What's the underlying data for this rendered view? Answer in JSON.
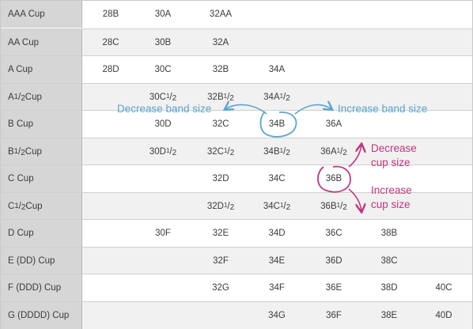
{
  "columns": [
    "col1",
    "col2",
    "col3",
    "col4",
    "col5",
    "col6",
    "col7"
  ],
  "rows": [
    {
      "label": "AAA Cup",
      "cells": [
        "28B",
        "30A",
        "32AA",
        "",
        "",
        "",
        ""
      ]
    },
    {
      "label": "AA Cup",
      "cells": [
        "28C",
        "30B",
        "32A",
        "",
        "",
        "",
        ""
      ]
    },
    {
      "label": "A Cup",
      "cells": [
        "28D",
        "30C",
        "32B",
        "34A",
        "",
        "",
        ""
      ]
    },
    {
      "label": "A 1/2 Cup",
      "cells": [
        "",
        "30C1/2",
        "32B1/2",
        "34A1/2",
        "",
        "",
        ""
      ]
    },
    {
      "label": "B Cup",
      "cells": [
        "",
        "30D",
        "32C",
        "34B",
        "36A",
        "",
        ""
      ]
    },
    {
      "label": "B 1/2 Cup",
      "cells": [
        "",
        "30D1/2",
        "32C1/2",
        "34B1/2",
        "36A1/2",
        "",
        ""
      ]
    },
    {
      "label": "C Cup",
      "cells": [
        "",
        "",
        "32D",
        "34C",
        "36B",
        "",
        ""
      ]
    },
    {
      "label": "C 1/2 Cup",
      "cells": [
        "",
        "",
        "32D1/2",
        "34C1/2",
        "36B1/2",
        "",
        ""
      ]
    },
    {
      "label": "D Cup",
      "cells": [
        "",
        "30F",
        "32E",
        "34D",
        "36C",
        "38B",
        ""
      ]
    },
    {
      "label": "E (DD) Cup",
      "cells": [
        "",
        "",
        "32F",
        "34E",
        "36D",
        "38C",
        ""
      ]
    },
    {
      "label": "F (DDD) Cup",
      "cells": [
        "",
        "",
        "32G",
        "34F",
        "36E",
        "38D",
        "40C"
      ]
    },
    {
      "label": "G (DDDD) Cup",
      "cells": [
        "",
        "",
        "",
        "34G",
        "36F",
        "38E",
        "40D"
      ]
    }
  ],
  "annotations": {
    "decrease_band": "Decrease band size",
    "increase_band": "Increase band size",
    "decrease_cup_1": "Decrease",
    "decrease_cup_2": "cup size",
    "increase_cup_1": "Increase",
    "increase_cup_2": "cup size"
  },
  "colors": {
    "blue": "#5aa6cf",
    "magenta": "#c2357e",
    "label_bg": "#d6d6d6"
  }
}
